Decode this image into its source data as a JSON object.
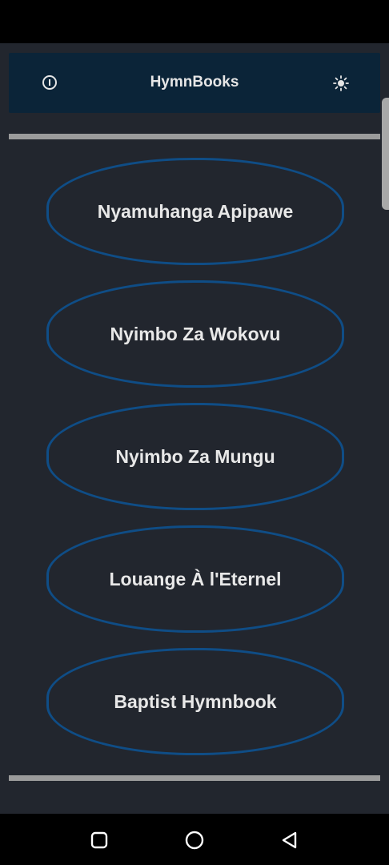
{
  "app": {
    "title": "HymnBooks",
    "accent_color": "#0f4d86",
    "header_color": "#0b2438",
    "background_color": "#22262e"
  },
  "header": {
    "info_icon": "info-circle-icon",
    "theme_icon": "sun-icon"
  },
  "books": [
    {
      "label": "Nyamuhanga Apipawe"
    },
    {
      "label": "Nyimbo Za Wokovu"
    },
    {
      "label": "Nyimbo Za Mungu"
    },
    {
      "label": "Louange À l'Eternel"
    },
    {
      "label": "Baptist Hymnbook"
    }
  ],
  "system_nav": {
    "recents_icon": "square-icon",
    "home_icon": "circle-icon",
    "back_icon": "triangle-back-icon"
  }
}
